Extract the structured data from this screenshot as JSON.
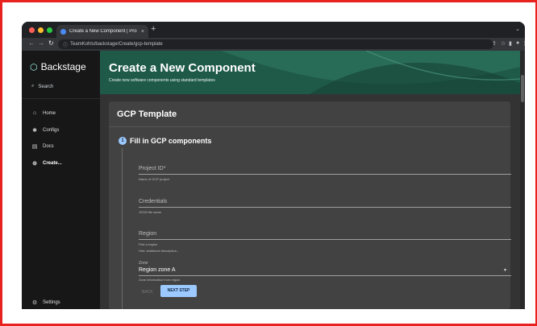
{
  "browser": {
    "tab_title": "Create a New Component | Pro",
    "tab_close": "×",
    "new_tab": "+",
    "url": "TeamKohls/backstage/Create/gcp-template"
  },
  "sidebar": {
    "brand": "Backstage",
    "search_label": "Search",
    "items": [
      {
        "label": "Home",
        "icon": "home-icon"
      },
      {
        "label": "Configs",
        "icon": "puzzle-icon"
      },
      {
        "label": "Docs",
        "icon": "docs-icon"
      },
      {
        "label": "Create...",
        "icon": "add-circle-icon"
      }
    ],
    "settings_label": "Settings"
  },
  "header": {
    "title": "Create a New Component",
    "subtitle": "Create new software components using standard templates"
  },
  "card": {
    "title": "GCP Template",
    "step": {
      "number": "1",
      "label": "Fill in GCP components"
    },
    "fields": [
      {
        "label": "Project ID*",
        "help": "Name of GCP project"
      },
      {
        "label": "Credentials",
        "help": "JSON file name"
      },
      {
        "label": "Region",
        "help": "Pick a region",
        "hint": "Hint: additional description..."
      }
    ],
    "zone": {
      "label": "Zone",
      "value": "Region zone A",
      "help": "Zone information from region"
    },
    "back_label": "BACK",
    "next_label": "NEXT STEP"
  },
  "colors": {
    "accent": "#9cc9ff",
    "header": "#1f5a48",
    "frame": "#e8231f"
  }
}
